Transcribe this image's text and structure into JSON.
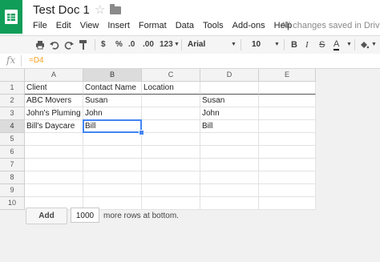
{
  "app": {
    "doc_title": "Test Doc 1",
    "save_status": "All changes saved in Drive"
  },
  "icons": {
    "logo": "sheets-logo-icon",
    "star": "star-icon",
    "folder": "folder-icon"
  },
  "menu": [
    "File",
    "Edit",
    "View",
    "Insert",
    "Format",
    "Data",
    "Tools",
    "Add-ons",
    "Help"
  ],
  "toolbar": {
    "currency": "$",
    "percent": "%",
    "decrease_decimals": ".0",
    "increase_decimals": ".00",
    "more_formats": "123",
    "font": "Arial",
    "font_size": "10",
    "bold": "B",
    "italic": "I",
    "strikethrough": "S",
    "text_color": "A"
  },
  "formula_bar": {
    "fx": "fx",
    "value": "=D4"
  },
  "grid": {
    "columns": [
      "A",
      "B",
      "C",
      "D",
      "E"
    ],
    "rows": [
      "1",
      "2",
      "3",
      "4",
      "5",
      "6",
      "7",
      "8",
      "9",
      "10"
    ],
    "cells": [
      [
        "Client",
        "Contact Name",
        "Location",
        "",
        ""
      ],
      [
        "ABC Movers",
        "Susan",
        "",
        "Susan",
        ""
      ],
      [
        "John's Pluming",
        "John",
        "",
        "John",
        ""
      ],
      [
        "Bill's Daycare",
        "Bill",
        "",
        "Bill",
        ""
      ],
      [
        "",
        "",
        "",
        "",
        ""
      ],
      [
        "",
        "",
        "",
        "",
        ""
      ],
      [
        "",
        "",
        "",
        "",
        ""
      ],
      [
        "",
        "",
        "",
        "",
        ""
      ],
      [
        "",
        "",
        "",
        "",
        ""
      ],
      [
        "",
        "",
        "",
        "",
        ""
      ]
    ],
    "selected_cell": "B4"
  },
  "bottom": {
    "add_label": "Add",
    "rows_value": "1000",
    "more_rows_text": "more rows at bottom."
  },
  "colors": {
    "accent": "#0f9d58",
    "selection": "#4285f4",
    "formula_ref": "#f4a11e"
  }
}
